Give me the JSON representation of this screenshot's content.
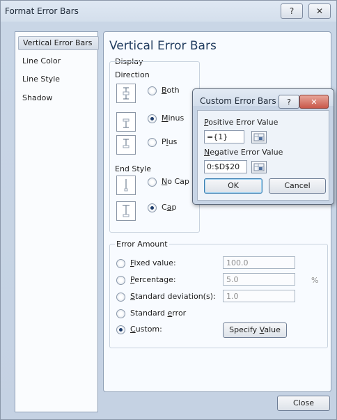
{
  "dialog": {
    "title": "Format Error Bars",
    "help_glyph": "?",
    "close_glyph": "✕"
  },
  "nav": {
    "items": [
      {
        "label": "Vertical Error Bars",
        "selected": true
      },
      {
        "label": "Line Color",
        "selected": false
      },
      {
        "label": "Line Style",
        "selected": false
      },
      {
        "label": "Shadow",
        "selected": false
      }
    ]
  },
  "panel": {
    "heading": "Vertical Error Bars",
    "display_label": "Display",
    "direction_label": "Direction",
    "direction_options": [
      {
        "label": "Both",
        "key": "B",
        "rest": "oth",
        "checked": false
      },
      {
        "label": "Minus",
        "key": "M",
        "rest": "inus",
        "checked": true
      },
      {
        "label": "Plus",
        "pre": "P",
        "key": "l",
        "rest": "us",
        "checked": false
      }
    ],
    "end_style_label": "End Style",
    "end_style_options": [
      {
        "label": "No Cap",
        "key": "N",
        "rest": "o Cap",
        "checked": false
      },
      {
        "label": "Cap",
        "pre": "C",
        "key": "a",
        "rest": "p",
        "checked": true
      }
    ],
    "error_amount_label": "Error Amount",
    "error_options": [
      {
        "label": "Fixed value:",
        "key": "F",
        "rest": "ixed value:",
        "value": "100.0",
        "unit": ""
      },
      {
        "label": "Percentage:",
        "key": "P",
        "rest": "ercentage:",
        "value": "5.0",
        "unit": "%"
      },
      {
        "label": "Standard deviation(s):",
        "key": "S",
        "rest": "tandard deviation(s):",
        "value": "1.0",
        "unit": ""
      },
      {
        "label": "Standard error",
        "pre": "Standard ",
        "key": "e",
        "rest": "rror"
      },
      {
        "label": "Custom:",
        "key": "C",
        "rest": "ustom:",
        "checked": true
      }
    ],
    "specify_button": {
      "pre": "Specify ",
      "key": "V",
      "rest": "alue"
    }
  },
  "footer": {
    "close_label": "Close"
  },
  "popup": {
    "title": "Custom Error Bars",
    "help_glyph": "?",
    "close_glyph": "✕",
    "positive_label": {
      "key": "P",
      "rest": "ositive Error Value"
    },
    "positive_value": "={1}",
    "negative_label": {
      "key": "N",
      "rest": "egative Error Value"
    },
    "negative_value": "0:$D$20",
    "ok_label": "OK",
    "cancel_label": "Cancel"
  }
}
